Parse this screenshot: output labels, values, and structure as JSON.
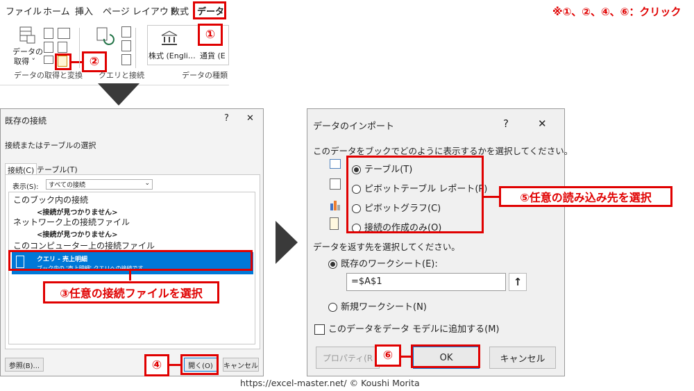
{
  "ribbon": {
    "tabs": [
      "ファイル",
      "ホーム",
      "挿入",
      "ページ レイアウト",
      "数式",
      "データ"
    ],
    "get_data_label": "データの",
    "get_data_label2": "取得 ˅",
    "group1_label": "データの取得と変換",
    "group2_label": "クエリと接続",
    "group3_label": "データの種類",
    "stock_label": "株式 (Engli…",
    "currency_label": "通貨 (E"
  },
  "annotation_note": "※①、②、④、⑥：クリック",
  "steps": {
    "s1": "①",
    "s2": "②",
    "s4": "④",
    "s6": "⑥",
    "s3": "③任意の接続ファイルを選択",
    "s5": "⑤任意の読み込み先を選択"
  },
  "existing": {
    "title": "既存の接続",
    "help": "?",
    "close": "✕",
    "subtitle": "接続またはテーブルの選択",
    "tab_conn": "接続(C)",
    "tab_table": "テーブル(T)",
    "show_label": "表示(S):",
    "show_value": "すべての接続",
    "sec1": "このブック内の接続",
    "none1": "<接続が見つかりません>",
    "sec2": "ネットワーク上の接続ファイル",
    "none2": "<接続が見つかりません>",
    "sec3": "このコンピューター上の接続ファイル",
    "sel_title": "クエリ - 売上明細",
    "sel_desc": "ブック内の '売上明細' クエリへの接続です。",
    "browse": "参照(B)...",
    "open": "開く(O)",
    "cancel": "キャンセル"
  },
  "import": {
    "title": "データのインポート",
    "help": "?",
    "close": "✕",
    "q1": "このデータをブックでどのように表示するかを選択してください。",
    "opt_table": "テーブル(T)",
    "opt_pivot": "ピボットテーブル レポート(P)",
    "opt_chart": "ピボットグラフ(C)",
    "opt_conn": "接続の作成のみ(O)",
    "q2": "データを返す先を選択してください。",
    "dest_existing": "既存のワークシート(E):",
    "dest_value": "=$A$1",
    "dest_new": "新規ワークシート(N)",
    "add_model": "このデータをデータ モデルに追加する(M)",
    "props": "プロパティ(R",
    "ok": "OK",
    "cancel": "キャンセル"
  },
  "footer": "https://excel-master.net/ © Koushi Morita",
  "colors": {
    "accent_red": "#e00000",
    "selection_blue": "#0078d7",
    "arrow": "#3a3a3a"
  }
}
